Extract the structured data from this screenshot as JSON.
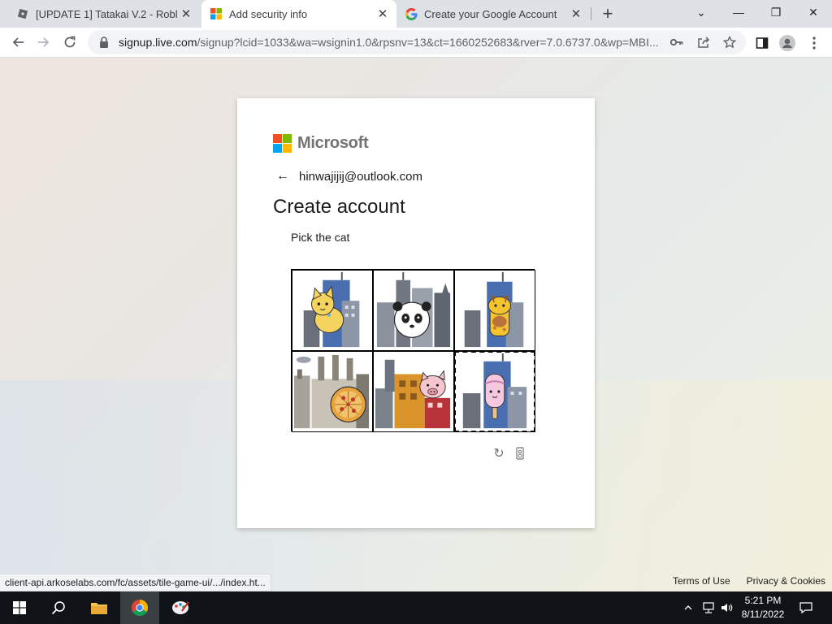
{
  "browser": {
    "tabs": [
      {
        "title": "[UPDATE 1] Tatakai V.2 - Roblox",
        "icon": "roblox-icon",
        "active": false
      },
      {
        "title": "Add security info",
        "icon": "microsoft-icon",
        "active": true
      },
      {
        "title": "Create your Google Account",
        "icon": "google-icon",
        "active": false
      }
    ],
    "close_glyph": "✕",
    "new_tab_glyph": "+",
    "window_controls": {
      "dropdown": "⌄",
      "minimize": "—",
      "restore": "❐",
      "close": "✕"
    },
    "address": {
      "host": "signup.live.com",
      "path": "/signup?lcid=1033&wa=wsignin1.0&rpsnv=13&ct=1660252683&rver=7.0.6737.0&wp=MBI..."
    },
    "status_url": "client-api.arkoselabs.com/fc/assets/tile-game-ui/.../index.ht..."
  },
  "signup": {
    "brand": "Microsoft",
    "brand_colors": [
      "#f25022",
      "#7fba00",
      "#00a4ef",
      "#ffb900"
    ],
    "back_glyph": "←",
    "email": "hinwajijij@outlook.com",
    "heading": "Create account",
    "instruction": "Pick the cat",
    "tiles": [
      {
        "subject": "cat",
        "selected": false
      },
      {
        "subject": "panda",
        "selected": false
      },
      {
        "subject": "giraffe",
        "selected": false
      },
      {
        "subject": "pizza",
        "selected": false
      },
      {
        "subject": "pig",
        "selected": false
      },
      {
        "subject": "popsicle",
        "selected": true
      }
    ],
    "reload_glyph": "↻",
    "audio_glyph": "▯"
  },
  "footer": {
    "terms": "Terms of Use",
    "privacy": "Privacy & Cookies"
  },
  "taskbar": {
    "time": "5:21 PM",
    "date": "8/11/2022"
  }
}
